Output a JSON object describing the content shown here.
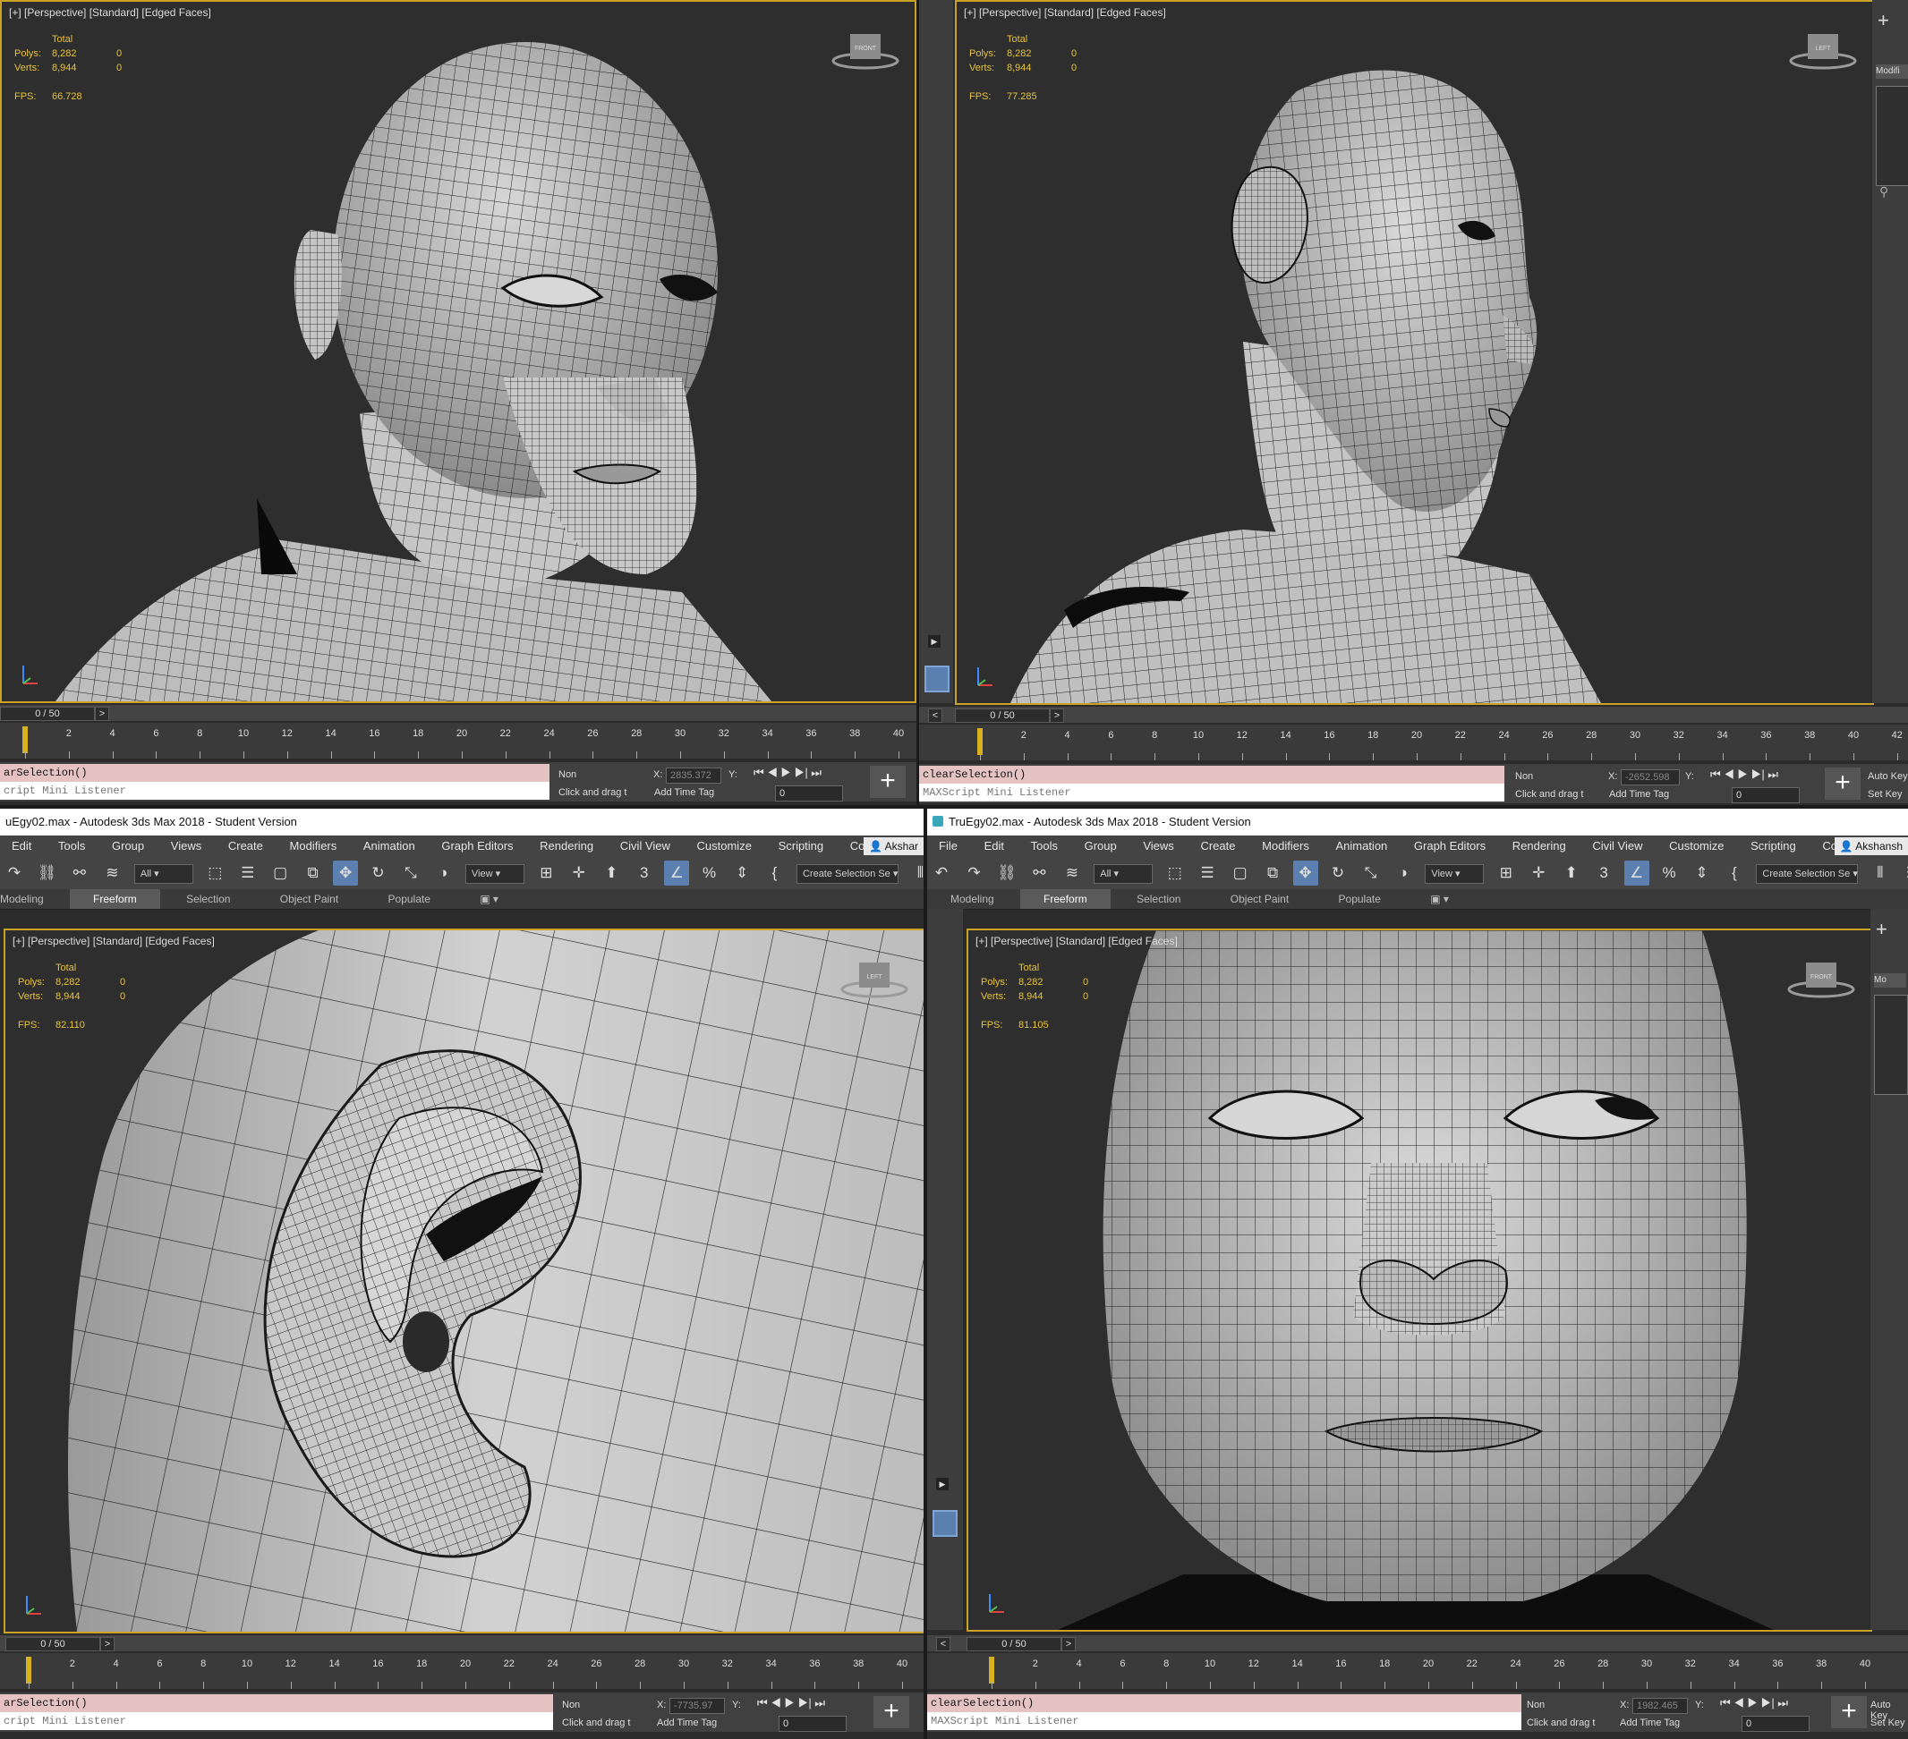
{
  "app": {
    "title": "TruEgy02.max - Autodesk 3ds Max 2018 - Student Version",
    "title_cropped": "uEgy02.max - Autodesk 3ds Max 2018 - Student Version",
    "user": "Akshansh",
    "user_cropped": "Akshar"
  },
  "menu": [
    "File",
    "Edit",
    "Tools",
    "Group",
    "Views",
    "Create",
    "Modifiers",
    "Animation",
    "Graph Editors",
    "Rendering",
    "Civil View",
    "Customize",
    "Scripting",
    "Content"
  ],
  "toolbar": {
    "filter_value": "All",
    "refcoord_value": "View",
    "selection_set_placeholder": "Create Selection Se"
  },
  "ribbon": {
    "tabs": [
      "Modeling",
      "Freeform",
      "Selection",
      "Object Paint",
      "Populate"
    ],
    "active": "Freeform"
  },
  "viewports": {
    "label": "[+] [Perspective] [Standard] [Edged Faces]",
    "stats": {
      "header": "Total",
      "polys_label": "Polys:",
      "polys_value": "8,282",
      "polys_sel": "0",
      "verts_label": "Verts:",
      "verts_value": "8,944",
      "verts_sel": "0",
      "fps_label": "FPS:"
    },
    "fps": {
      "top_left": "66.728",
      "top_right": "77.285",
      "bottom_left": "82.110",
      "bottom_right": "81.105"
    },
    "viewcube": {
      "top_left": "FRONT",
      "top_right": "LEFT",
      "bottom_left": "LEFT",
      "bottom_right": "FRONT"
    }
  },
  "timeline": {
    "frame_display": "0 / 50",
    "ticks_main": [
      "0",
      "2",
      "4",
      "6",
      "8",
      "10",
      "12",
      "14",
      "16",
      "18",
      "20",
      "22",
      "24",
      "26",
      "28",
      "30",
      "32",
      "34",
      "36",
      "38",
      "40"
    ],
    "ticks_wide": [
      "0",
      "2",
      "4",
      "6",
      "8",
      "10",
      "12",
      "14",
      "16",
      "18",
      "20",
      "22",
      "24",
      "26",
      "28",
      "30",
      "32",
      "34",
      "36",
      "38",
      "40",
      "42"
    ]
  },
  "status": {
    "listener_command": "clearSelection()",
    "listener_command_cropped": "arSelection()",
    "listener_hint": "MAXScript Mini Listener",
    "listener_hint_cropped": "cript Mini Listener",
    "none_sel": "Non",
    "prompt": "Click and drag t",
    "add_time_tag": "Add Time Tag",
    "x_label": "X:",
    "y_label": "Y:",
    "x_values": {
      "top_left": "2835.372",
      "top_right": "-2652.598",
      "bottom_left": "-7735.97",
      "bottom_right": "1982.465"
    },
    "frame_value": "0",
    "auto_key": "Auto Key",
    "set_key": "Set Key",
    "modify_tab": "Modifi",
    "modify_tab_short": "Mo"
  },
  "colors": {
    "viewport_bg": "#2e2e2e",
    "active_border": "#c9a227",
    "stats_text": "#e8c33a",
    "listener_bg": "#e6c3c3",
    "mesh_fill": "#c2c2c2",
    "wire": "#1c1c1c"
  },
  "icons": [
    "undo-icon",
    "redo-icon",
    "link-icon",
    "unlink-icon",
    "bind-space-warp-icon",
    "select-object-icon",
    "select-by-name-icon",
    "rect-region-icon",
    "window-crossing-icon",
    "move-icon",
    "rotate-icon",
    "scale-icon",
    "place-icon",
    "pivot-icon",
    "snap-3d-icon",
    "angle-snap-icon",
    "percent-snap-icon",
    "spinner-snap-icon",
    "named-selection-icon",
    "mirror-icon",
    "align-icon",
    "layer-icon",
    "play-icon",
    "add-icon",
    "viewcube-icon",
    "axis-tripod-icon",
    "key-icon"
  ]
}
